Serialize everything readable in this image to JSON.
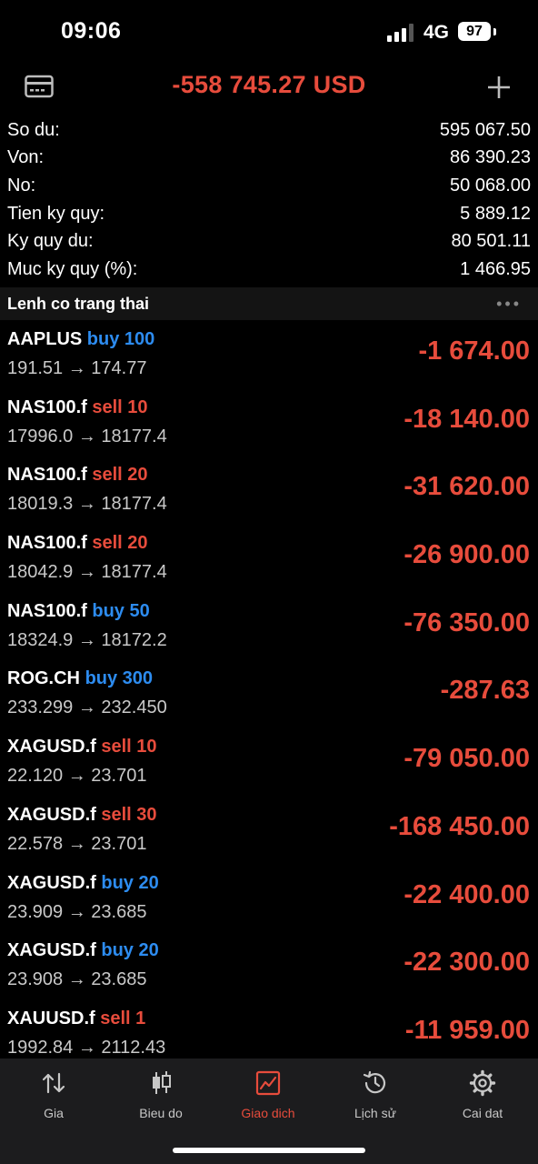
{
  "status": {
    "time": "09:06",
    "network": "4G",
    "battery": "97"
  },
  "header": {
    "balance": "-558 745.27 USD"
  },
  "summary": [
    {
      "label": "So du:",
      "value": "595 067.50"
    },
    {
      "label": "Von:",
      "value": "86 390.23"
    },
    {
      "label": "No:",
      "value": "50 068.00"
    },
    {
      "label": "Tien ky quy:",
      "value": "5 889.12"
    },
    {
      "label": "Ky quy du:",
      "value": "80 501.11"
    },
    {
      "label": "Muc ky quy (%):",
      "value": "1 466.95"
    }
  ],
  "section": {
    "title": "Lenh co trang thai",
    "more": "•••"
  },
  "positions": [
    {
      "symbol": "AAPLUS",
      "type": "buy 100",
      "side": "buy",
      "prices": "191.51 → 174.77",
      "profit": "-1 674.00"
    },
    {
      "symbol": "NAS100.f",
      "type": "sell 10",
      "side": "sell",
      "prices": "17996.0 → 18177.4",
      "profit": "-18 140.00"
    },
    {
      "symbol": "NAS100.f",
      "type": "sell 20",
      "side": "sell",
      "prices": "18019.3 → 18177.4",
      "profit": "-31 620.00"
    },
    {
      "symbol": "NAS100.f",
      "type": "sell 20",
      "side": "sell",
      "prices": "18042.9 → 18177.4",
      "profit": "-26 900.00"
    },
    {
      "symbol": "NAS100.f",
      "type": "buy 50",
      "side": "buy",
      "prices": "18324.9 → 18172.2",
      "profit": "-76 350.00"
    },
    {
      "symbol": "ROG.CH",
      "type": "buy 300",
      "side": "buy",
      "prices": "233.299 → 232.450",
      "profit": "-287.63"
    },
    {
      "symbol": "XAGUSD.f",
      "type": "sell 10",
      "side": "sell",
      "prices": "22.120 → 23.701",
      "profit": "-79 050.00"
    },
    {
      "symbol": "XAGUSD.f",
      "type": "sell 30",
      "side": "sell",
      "prices": "22.578 → 23.701",
      "profit": "-168 450.00"
    },
    {
      "symbol": "XAGUSD.f",
      "type": "buy 20",
      "side": "buy",
      "prices": "23.909 → 23.685",
      "profit": "-22 400.00"
    },
    {
      "symbol": "XAGUSD.f",
      "type": "buy 20",
      "side": "buy",
      "prices": "23.908 → 23.685",
      "profit": "-22 300.00"
    },
    {
      "symbol": "XAUUSD.f",
      "type": "sell 1",
      "side": "sell",
      "prices": "1992.84 → 2112.43",
      "profit": "-11 959.00"
    }
  ],
  "tabs": [
    {
      "label": "Gia",
      "icon": "arrows-updown-icon"
    },
    {
      "label": "Bieu do",
      "icon": "candlestick-icon"
    },
    {
      "label": "Giao dich",
      "icon": "trade-chart-icon",
      "active": true
    },
    {
      "label": "Lịch sử",
      "icon": "history-icon"
    },
    {
      "label": "Cai dat",
      "icon": "gear-icon"
    }
  ],
  "colors": {
    "loss": "#e74c3c",
    "buy": "#2d8cf0",
    "sell": "#e74c3c",
    "background": "#000000",
    "tabbar": "#1c1c1e"
  }
}
